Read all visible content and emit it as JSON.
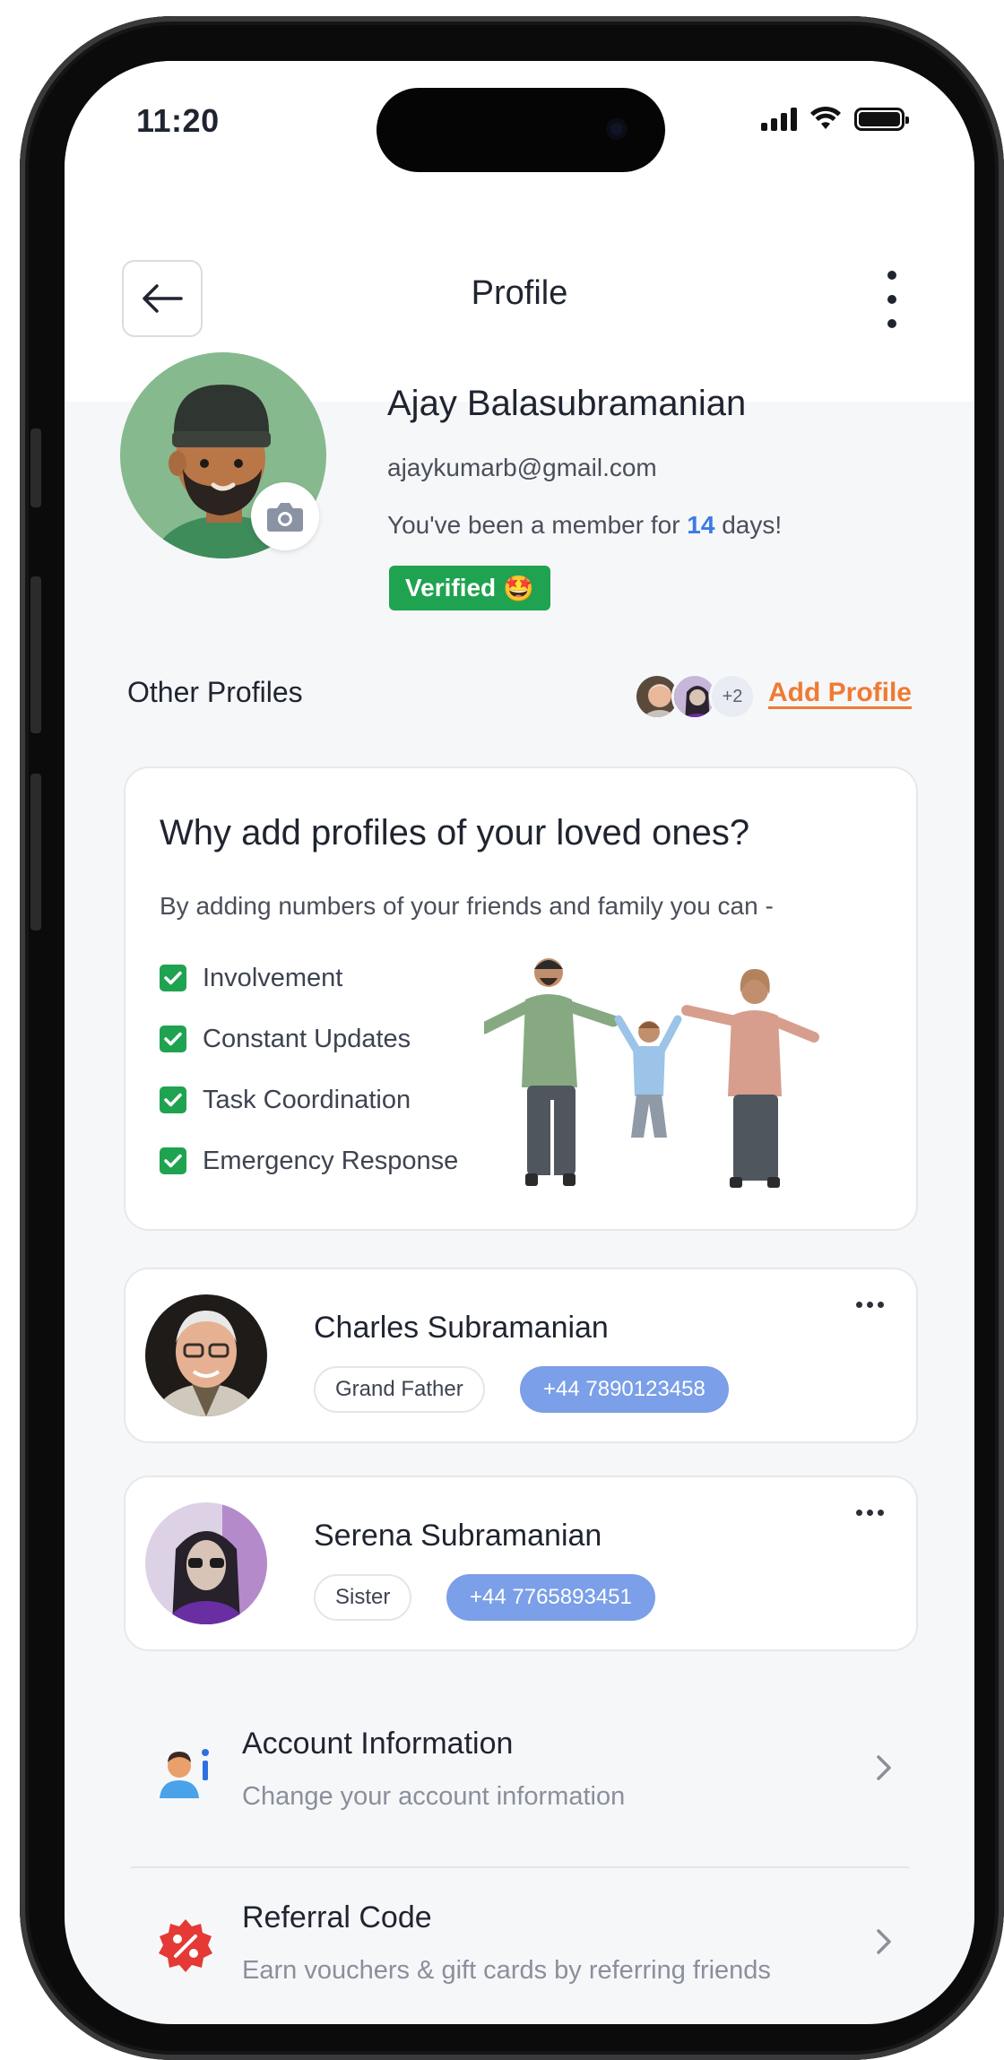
{
  "status_bar": {
    "time": "11:20"
  },
  "header": {
    "title": "Profile"
  },
  "profile": {
    "name": "Ajay Balasubramanian",
    "email": "ajaykumarb@gmail.com",
    "member_prefix": "You've been a member for ",
    "member_days": "14",
    "member_suffix": " days!",
    "verified_label": "Verified",
    "verified_emoji": "🤩"
  },
  "other_profiles": {
    "label": "Other Profiles",
    "extra_count": "+2",
    "add_label": "Add Profile"
  },
  "why_card": {
    "title": "Why add profiles of your loved ones?",
    "subtitle": "By adding numbers of your friends and family you can -",
    "benefits": [
      "Involvement",
      "Constant Updates",
      "Task Coordination",
      "Emergency Response"
    ]
  },
  "contacts": [
    {
      "name": "Charles Subramanian",
      "relation": "Grand Father",
      "phone": "+44 7890123458"
    },
    {
      "name": "Serena Subramanian",
      "relation": "Sister",
      "phone": "+44 7765893451"
    }
  ],
  "settings": [
    {
      "title": "Account Information",
      "subtitle": "Change your account information",
      "icon": "account-info-icon"
    },
    {
      "title": "Referral Code",
      "subtitle": "Earn vouchers & gift cards by referring friends",
      "icon": "discount-badge-icon"
    }
  ],
  "colors": {
    "accent_blue": "#3b7be6",
    "verified_green": "#1fa350",
    "add_profile_orange": "#f07a33",
    "phone_chip": "#7b9fe8",
    "avatar_bg": "#86ba8e"
  }
}
